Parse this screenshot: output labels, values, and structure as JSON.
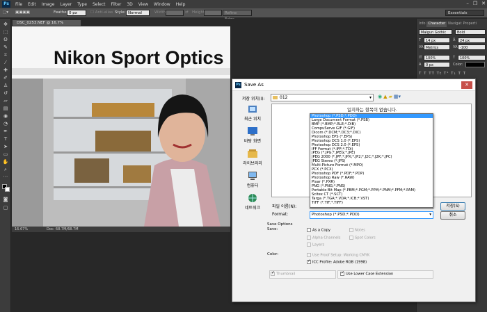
{
  "menubar": {
    "logo": "Ps",
    "items": [
      "File",
      "Edit",
      "Image",
      "Layer",
      "Type",
      "Select",
      "Filter",
      "3D",
      "View",
      "Window",
      "Help"
    ]
  },
  "options": {
    "feather_label": "Feather:",
    "feather_value": "0 px",
    "antialias_label": "Anti-alias",
    "style_label": "Style:",
    "style_value": "Normal",
    "width_label": "Width:",
    "height_label": "Height:",
    "refine_label": "Refine Edge...",
    "workspace": "Essentials"
  },
  "document": {
    "tab_title": "DSC_0253.NEF @ 16.7% (RGB/8*)",
    "zoom": "16.67%",
    "doc_info": "Doc: 68.7M/68.7M",
    "sign_text": "Nikon Sport Optics"
  },
  "right_panel": {
    "tabs": [
      "Info",
      "Character",
      "Navigat",
      "Properti"
    ],
    "font_family": "Malgun Gothic",
    "font_style": "Bold",
    "size": "14 px",
    "leading": "24 px",
    "kerning": "Metrics",
    "tracking": "-100",
    "vscale": "100%",
    "hscale": "100%",
    "baseline": "0 px",
    "color_label": "Color:"
  },
  "dialog": {
    "title": "Save As",
    "close": "✕",
    "save_in_label": "저장 위치(I):",
    "folder": "012",
    "empty_message": "일치하는 항목이 없습니다.",
    "places": [
      "최근 위치",
      "바탕 화면",
      "라이브러리",
      "컴퓨터",
      "네트워크"
    ],
    "filename_label": "파일 이름(N):",
    "format_label": "Format:",
    "format_selected": "Photoshop (*.PSD;*.PDD)",
    "formats": [
      "Photoshop (*.PSD;*.PDD)",
      "Large Document Format (*.PSB)",
      "BMP (*.BMP;*.RLE;*.DIB)",
      "CompuServe GIF (*.GIF)",
      "Dicom (*.DCM;*.DC3;*.DIC)",
      "Photoshop EPS (*.EPS)",
      "Photoshop DCS 1.0 (*.EPS)",
      "Photoshop DCS 2.0 (*.EPS)",
      "IFF Format (*.IFF;*.TDI)",
      "JPEG (*.JPG;*.JPEG;*.JPE)",
      "JPEG 2000 (*.JPF;*.JPX;*.JP2;*.J2C;*.J2K;*.JPC)",
      "JPEG Stereo (*.JPS)",
      "Multi-Picture Format (*.MPO)",
      "PCX (*.PCX)",
      "Photoshop PDF (*.PDF;*.PDP)",
      "Photoshop Raw (*.RAW)",
      "Pixar (*.PXR)",
      "PNG (*.PNG;*.PNS)",
      "Portable Bit Map (*.PBM;*.PGM;*.PPM;*.PNM;*.PFM;*.PAM)",
      "Scitex CT (*.SCT)",
      "Targa (*.TGA;*.VDA;*.ICB;*.VST)",
      "TIFF (*.TIF;*.TIFF)"
    ],
    "save_button": "저장(S)",
    "cancel_button": "취소",
    "save_options_label": "Save Options",
    "save_label": "Save:",
    "as_copy": "As a Copy",
    "notes": "Notes",
    "alpha_channels": "Alpha Channels",
    "spot_colors": "Spot Colors",
    "layers": "Layers",
    "color_label": "Color:",
    "use_proof": "Use Proof Setup: Working CMYK",
    "icc_profile": "ICC Profile: Adobe RGB (1998)",
    "thumbnail": "Thumbnail",
    "lower_case": "Use Lower Case Extension"
  }
}
